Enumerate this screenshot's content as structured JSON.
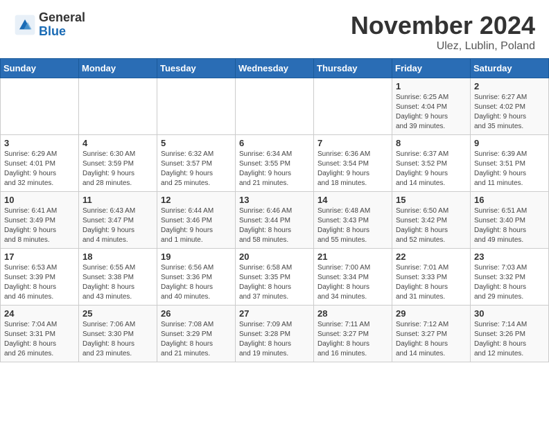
{
  "header": {
    "logo": {
      "general": "General",
      "blue": "Blue"
    },
    "month": "November 2024",
    "location": "Ulez, Lublin, Poland"
  },
  "weekdays": [
    "Sunday",
    "Monday",
    "Tuesday",
    "Wednesday",
    "Thursday",
    "Friday",
    "Saturday"
  ],
  "weeks": [
    [
      {
        "day": "",
        "info": ""
      },
      {
        "day": "",
        "info": ""
      },
      {
        "day": "",
        "info": ""
      },
      {
        "day": "",
        "info": ""
      },
      {
        "day": "",
        "info": ""
      },
      {
        "day": "1",
        "info": "Sunrise: 6:25 AM\nSunset: 4:04 PM\nDaylight: 9 hours\nand 39 minutes."
      },
      {
        "day": "2",
        "info": "Sunrise: 6:27 AM\nSunset: 4:02 PM\nDaylight: 9 hours\nand 35 minutes."
      }
    ],
    [
      {
        "day": "3",
        "info": "Sunrise: 6:29 AM\nSunset: 4:01 PM\nDaylight: 9 hours\nand 32 minutes."
      },
      {
        "day": "4",
        "info": "Sunrise: 6:30 AM\nSunset: 3:59 PM\nDaylight: 9 hours\nand 28 minutes."
      },
      {
        "day": "5",
        "info": "Sunrise: 6:32 AM\nSunset: 3:57 PM\nDaylight: 9 hours\nand 25 minutes."
      },
      {
        "day": "6",
        "info": "Sunrise: 6:34 AM\nSunset: 3:55 PM\nDaylight: 9 hours\nand 21 minutes."
      },
      {
        "day": "7",
        "info": "Sunrise: 6:36 AM\nSunset: 3:54 PM\nDaylight: 9 hours\nand 18 minutes."
      },
      {
        "day": "8",
        "info": "Sunrise: 6:37 AM\nSunset: 3:52 PM\nDaylight: 9 hours\nand 14 minutes."
      },
      {
        "day": "9",
        "info": "Sunrise: 6:39 AM\nSunset: 3:51 PM\nDaylight: 9 hours\nand 11 minutes."
      }
    ],
    [
      {
        "day": "10",
        "info": "Sunrise: 6:41 AM\nSunset: 3:49 PM\nDaylight: 9 hours\nand 8 minutes."
      },
      {
        "day": "11",
        "info": "Sunrise: 6:43 AM\nSunset: 3:47 PM\nDaylight: 9 hours\nand 4 minutes."
      },
      {
        "day": "12",
        "info": "Sunrise: 6:44 AM\nSunset: 3:46 PM\nDaylight: 9 hours\nand 1 minute."
      },
      {
        "day": "13",
        "info": "Sunrise: 6:46 AM\nSunset: 3:44 PM\nDaylight: 8 hours\nand 58 minutes."
      },
      {
        "day": "14",
        "info": "Sunrise: 6:48 AM\nSunset: 3:43 PM\nDaylight: 8 hours\nand 55 minutes."
      },
      {
        "day": "15",
        "info": "Sunrise: 6:50 AM\nSunset: 3:42 PM\nDaylight: 8 hours\nand 52 minutes."
      },
      {
        "day": "16",
        "info": "Sunrise: 6:51 AM\nSunset: 3:40 PM\nDaylight: 8 hours\nand 49 minutes."
      }
    ],
    [
      {
        "day": "17",
        "info": "Sunrise: 6:53 AM\nSunset: 3:39 PM\nDaylight: 8 hours\nand 46 minutes."
      },
      {
        "day": "18",
        "info": "Sunrise: 6:55 AM\nSunset: 3:38 PM\nDaylight: 8 hours\nand 43 minutes."
      },
      {
        "day": "19",
        "info": "Sunrise: 6:56 AM\nSunset: 3:36 PM\nDaylight: 8 hours\nand 40 minutes."
      },
      {
        "day": "20",
        "info": "Sunrise: 6:58 AM\nSunset: 3:35 PM\nDaylight: 8 hours\nand 37 minutes."
      },
      {
        "day": "21",
        "info": "Sunrise: 7:00 AM\nSunset: 3:34 PM\nDaylight: 8 hours\nand 34 minutes."
      },
      {
        "day": "22",
        "info": "Sunrise: 7:01 AM\nSunset: 3:33 PM\nDaylight: 8 hours\nand 31 minutes."
      },
      {
        "day": "23",
        "info": "Sunrise: 7:03 AM\nSunset: 3:32 PM\nDaylight: 8 hours\nand 29 minutes."
      }
    ],
    [
      {
        "day": "24",
        "info": "Sunrise: 7:04 AM\nSunset: 3:31 PM\nDaylight: 8 hours\nand 26 minutes."
      },
      {
        "day": "25",
        "info": "Sunrise: 7:06 AM\nSunset: 3:30 PM\nDaylight: 8 hours\nand 23 minutes."
      },
      {
        "day": "26",
        "info": "Sunrise: 7:08 AM\nSunset: 3:29 PM\nDaylight: 8 hours\nand 21 minutes."
      },
      {
        "day": "27",
        "info": "Sunrise: 7:09 AM\nSunset: 3:28 PM\nDaylight: 8 hours\nand 19 minutes."
      },
      {
        "day": "28",
        "info": "Sunrise: 7:11 AM\nSunset: 3:27 PM\nDaylight: 8 hours\nand 16 minutes."
      },
      {
        "day": "29",
        "info": "Sunrise: 7:12 AM\nSunset: 3:27 PM\nDaylight: 8 hours\nand 14 minutes."
      },
      {
        "day": "30",
        "info": "Sunrise: 7:14 AM\nSunset: 3:26 PM\nDaylight: 8 hours\nand 12 minutes."
      }
    ]
  ]
}
